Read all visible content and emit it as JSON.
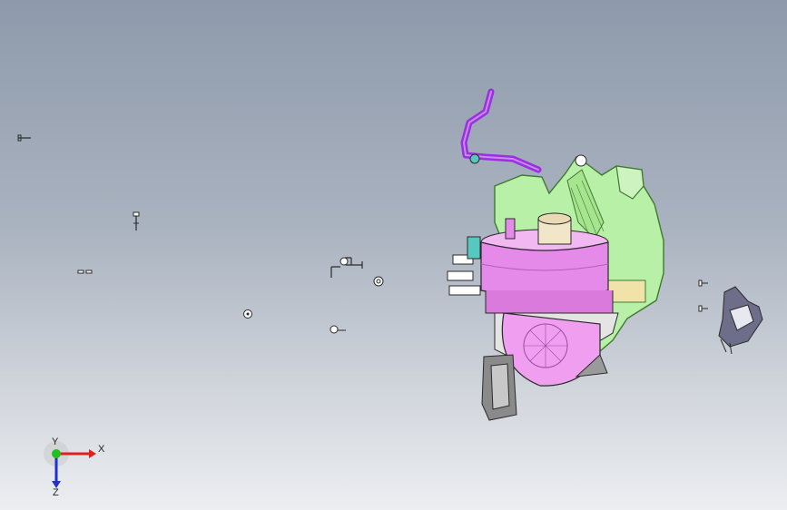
{
  "viewport": {
    "background_top": "#8e9aab",
    "background_bottom": "#eceef1"
  },
  "triad": {
    "x_label": "X",
    "y_label": "Y",
    "z_label": "Z",
    "x_color": "#e02020",
    "y_color": "#20c020",
    "z_color": "#2030d0"
  },
  "colors": {
    "housing_pink": "#e58ae8",
    "housing_light": "#f2b8f2",
    "frame_green": "#b9f0a8",
    "frame_dark": "#3f7a30",
    "pipe_purple": "#9b30e0",
    "outline": "#2a2a2a",
    "duct_gray": "#8a8a8a",
    "accent_teal": "#55c8c0"
  },
  "icons": [
    "screw-icon",
    "washer-icon",
    "clip-icon",
    "bracket-icon",
    "pipe-icon",
    "blower-housing-icon",
    "connector-icon",
    "axis-triad-icon"
  ]
}
